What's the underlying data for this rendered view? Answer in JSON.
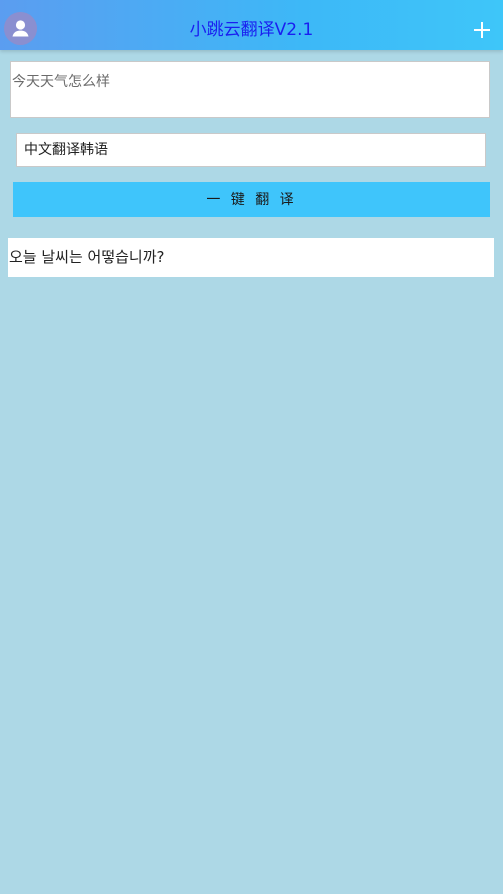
{
  "header": {
    "title": "小跳云翻译V2.1",
    "avatar_icon": "user-avatar-icon",
    "add_icon": "plus-icon"
  },
  "source_input": {
    "value": "今天天气怎么样"
  },
  "language_selector": {
    "selected": "中文翻译韩语"
  },
  "translate_button": {
    "label": "一 键 翻 译"
  },
  "result": {
    "text": "오늘 날씨는 어떻습니까?"
  },
  "colors": {
    "background": "#add8e6",
    "header_start": "#5b9df0",
    "header_end": "#3ec6f9",
    "title": "#1a1ff0",
    "button": "#3fc5fb"
  }
}
